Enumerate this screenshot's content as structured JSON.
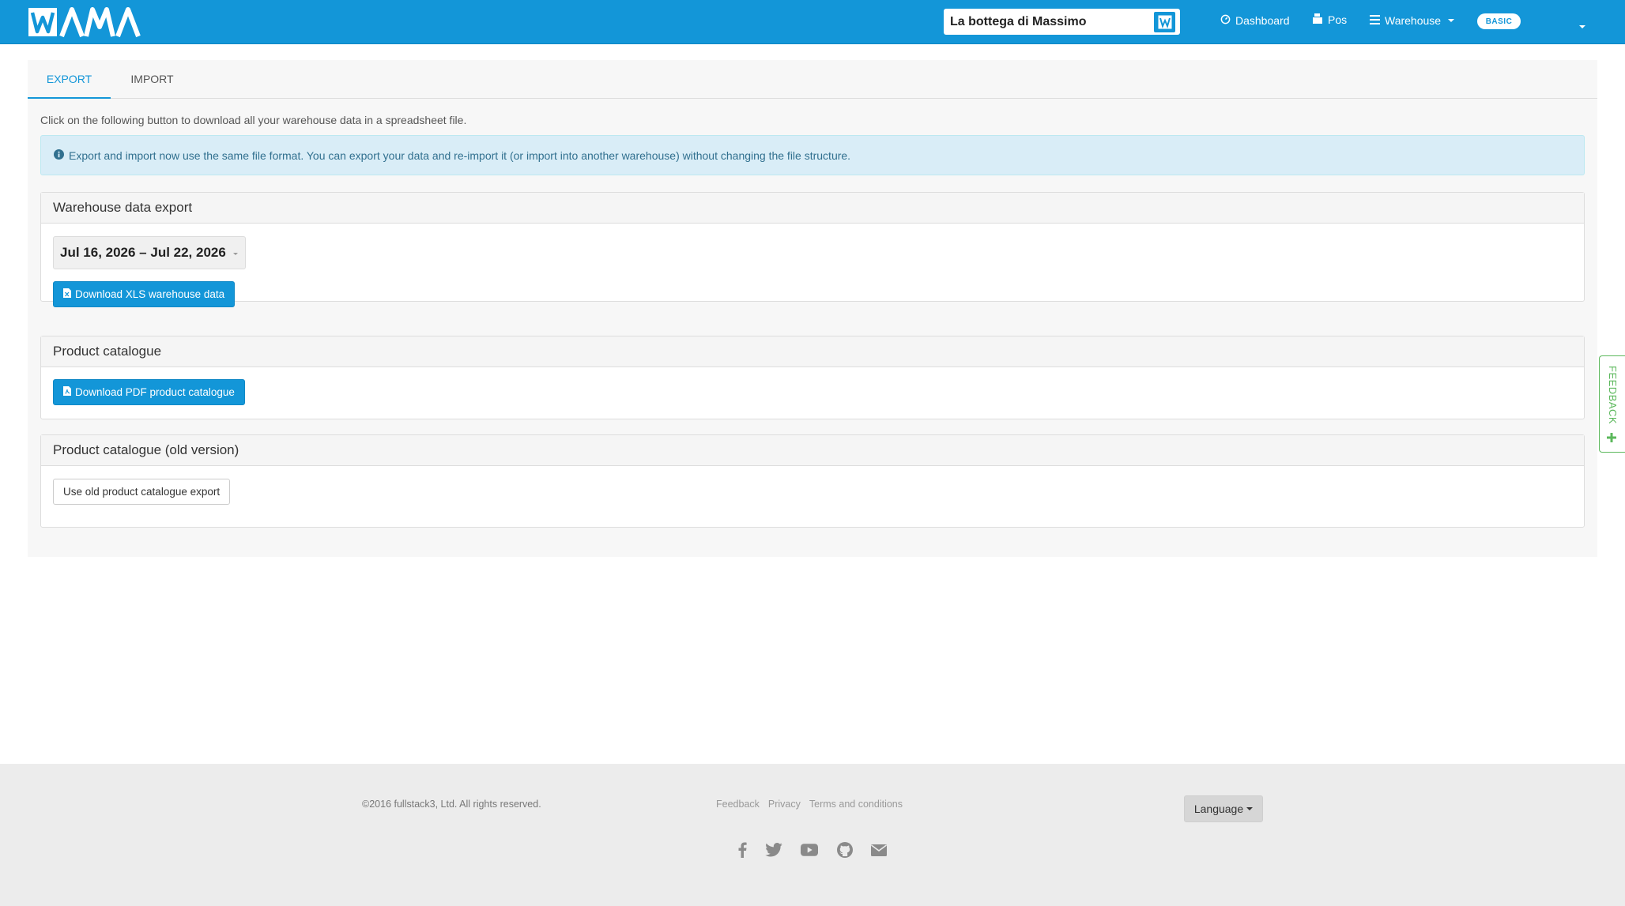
{
  "header": {
    "logo_text": "WAMA",
    "store_name": "La bottega di Massimo",
    "nav": {
      "dashboard": "Dashboard",
      "pos": "Pos",
      "warehouse": "Warehouse"
    },
    "plan_badge": "BASIC"
  },
  "tabs": [
    {
      "label": "EXPORT",
      "active": true
    },
    {
      "label": "IMPORT",
      "active": false
    }
  ],
  "intro_text": "Click on the following button to download all your warehouse data in a spreadsheet file.",
  "alert_text": "Export and import now use the same file format. You can export your data and re-import it (or import into another warehouse) without changing the file structure.",
  "sections": {
    "warehouse_export": {
      "title": "Warehouse data export",
      "date_range": "Jul 16, 2026 – Jul 22, 2026",
      "button": "Download XLS warehouse data"
    },
    "product_catalogue": {
      "title": "Product catalogue",
      "button": "Download PDF product catalogue"
    },
    "old_catalogue": {
      "title": "Product catalogue (old version)",
      "button": "Use old product catalogue export"
    }
  },
  "feedback_tab": "FEEDBACK",
  "footer": {
    "copyright": "©2016 fullstack3, Ltd. All rights reserved.",
    "links": [
      "Feedback",
      "Privacy",
      "Terms and conditions"
    ],
    "language_button": "Language",
    "social_icons": [
      "facebook-icon",
      "twitter-icon",
      "youtube-icon",
      "github-icon",
      "envelope-icon"
    ]
  },
  "colors": {
    "brand_blue": "#1396d8",
    "info_bg": "#d9edf7",
    "info_text": "#31708f",
    "feedback_green": "#5cb85c",
    "footer_bg": "#ececec"
  }
}
